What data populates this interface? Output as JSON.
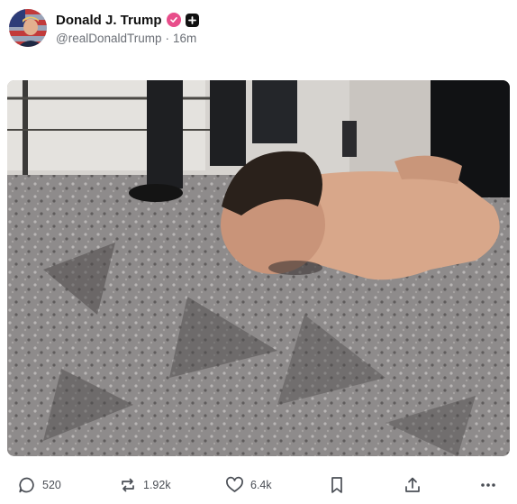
{
  "post": {
    "display_name": "Donald J. Trump",
    "handle": "@realDonaldTrump",
    "separator": "·",
    "time_ago": "16m"
  },
  "actions": {
    "replies": "520",
    "reposts": "1.92k",
    "likes": "6.4k"
  },
  "icons": [
    "verified-icon",
    "plus-icon",
    "reply-icon",
    "repost-icon",
    "like-icon",
    "bookmark-icon",
    "share-icon",
    "more-icon"
  ],
  "colors": {
    "verified_badge": "#e84d8a",
    "text_primary": "#111111",
    "text_secondary": "#6b6f76"
  }
}
